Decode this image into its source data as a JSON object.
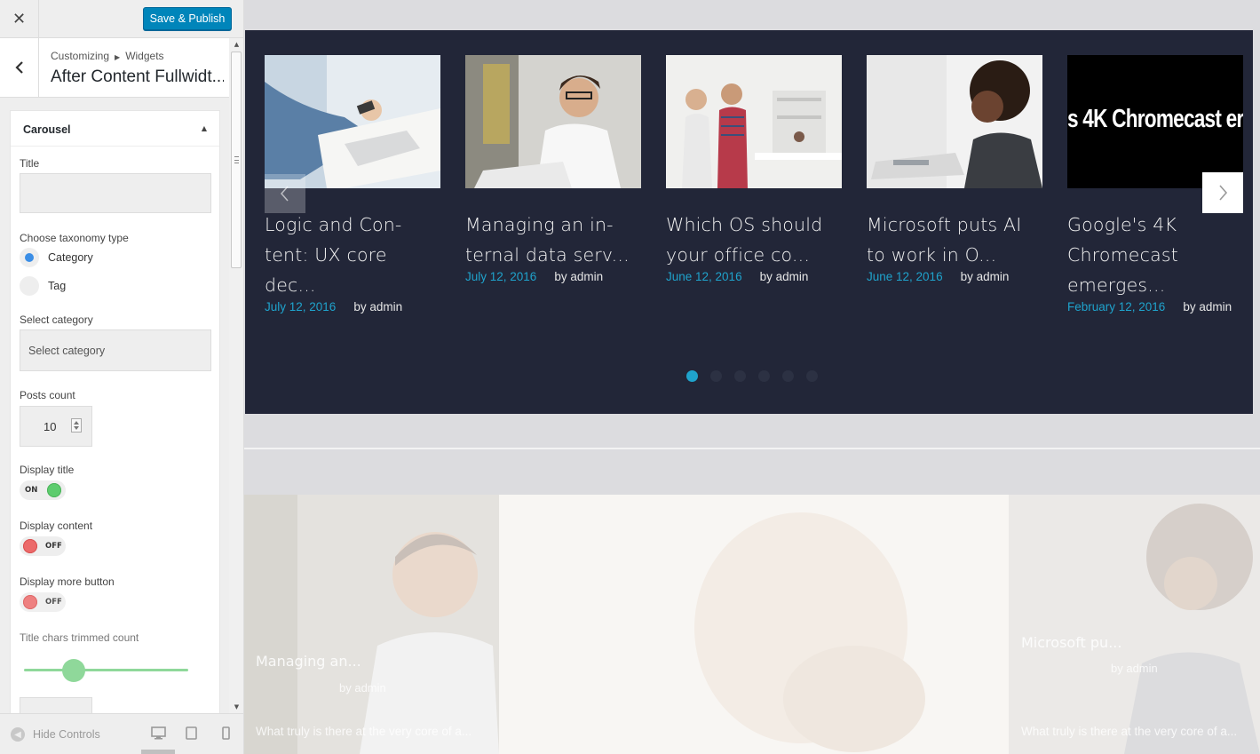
{
  "topbar": {
    "close_glyph": "✕",
    "publish_label": "Save & Publish"
  },
  "section": {
    "breadcrumb": [
      "Customizing",
      "Widgets"
    ],
    "title": "After Content Fullwidt..."
  },
  "widget": {
    "title": "Carousel",
    "fields": {
      "title_label": "Title",
      "title_value": "",
      "taxonomy_label": "Choose taxonomy type",
      "taxonomy_options": [
        "Category",
        "Tag"
      ],
      "taxonomy_selected": "Category",
      "category_label": "Select category",
      "category_value": "Select category",
      "posts_count_label": "Posts count",
      "posts_count_value": "10",
      "display_title_label": "Display title",
      "display_title_state": "ON",
      "display_content_label": "Display content",
      "display_content_state": "OFF",
      "display_more_label": "Display more button",
      "display_more_state": "OFF",
      "title_trim_label": "Title chars trimmed count",
      "title_trim_level": 0.3
    }
  },
  "footer": {
    "hide_label": "Hide Controls",
    "devices": [
      "desktop-icon",
      "tablet-icon",
      "mobile-icon"
    ]
  },
  "carousel": {
    "slides": [
      {
        "title": "Logic and Con-\ntent: UX core dec...",
        "date": "July 12, 2016",
        "author": "by admin"
      },
      {
        "title": "Managing an in-\nternal data serv...",
        "date": "July 12, 2016",
        "author": "by admin"
      },
      {
        "title": "Which OS should\nyour office co...",
        "date": "June 12, 2016",
        "author": "by admin"
      },
      {
        "title": "Microsoft puts AI\nto work in O...",
        "date": "June 12, 2016",
        "author": "by admin"
      },
      {
        "title": "Google's 4K\nChromecast\nemerges...",
        "date": "February 12, 2016",
        "author": "by admin",
        "thumb_text": "s 4K Chromecast er"
      }
    ],
    "dots_total": 6,
    "dots_active": 0
  },
  "faded_section": {
    "cards": [
      {
        "title": "Managing an...",
        "author": "by admin",
        "excerpt": "What truly is there at the very core of a..."
      },
      {
        "title": "Microsoft pu...",
        "author": "by admin",
        "excerpt": "What truly is there at the very core of a..."
      }
    ]
  },
  "colors": {
    "accent": "#0085ba",
    "carousel_bg": "#222638",
    "date": "#1fa3cc",
    "toggle_on": "#5dcc6e",
    "toggle_off": "#ec6a6a"
  }
}
